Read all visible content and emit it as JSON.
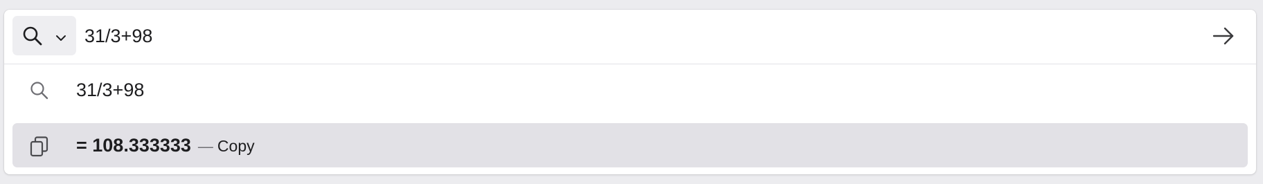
{
  "search": {
    "query": "31/3+98",
    "engine_icon": "search-icon",
    "engine_menu_icon": "chevron-down-icon",
    "go_icon": "arrow-right-icon"
  },
  "suggestions": [
    {
      "icon": "search-icon",
      "text": "31/3+98"
    },
    {
      "icon": "copy-icon",
      "result": "= 108.333333",
      "separator": "—",
      "action": "Copy",
      "selected": true
    }
  ],
  "colors": {
    "selected_row": "#e2e1e6",
    "engine_button": "#eeeef1",
    "text": "#1d1d1f"
  }
}
